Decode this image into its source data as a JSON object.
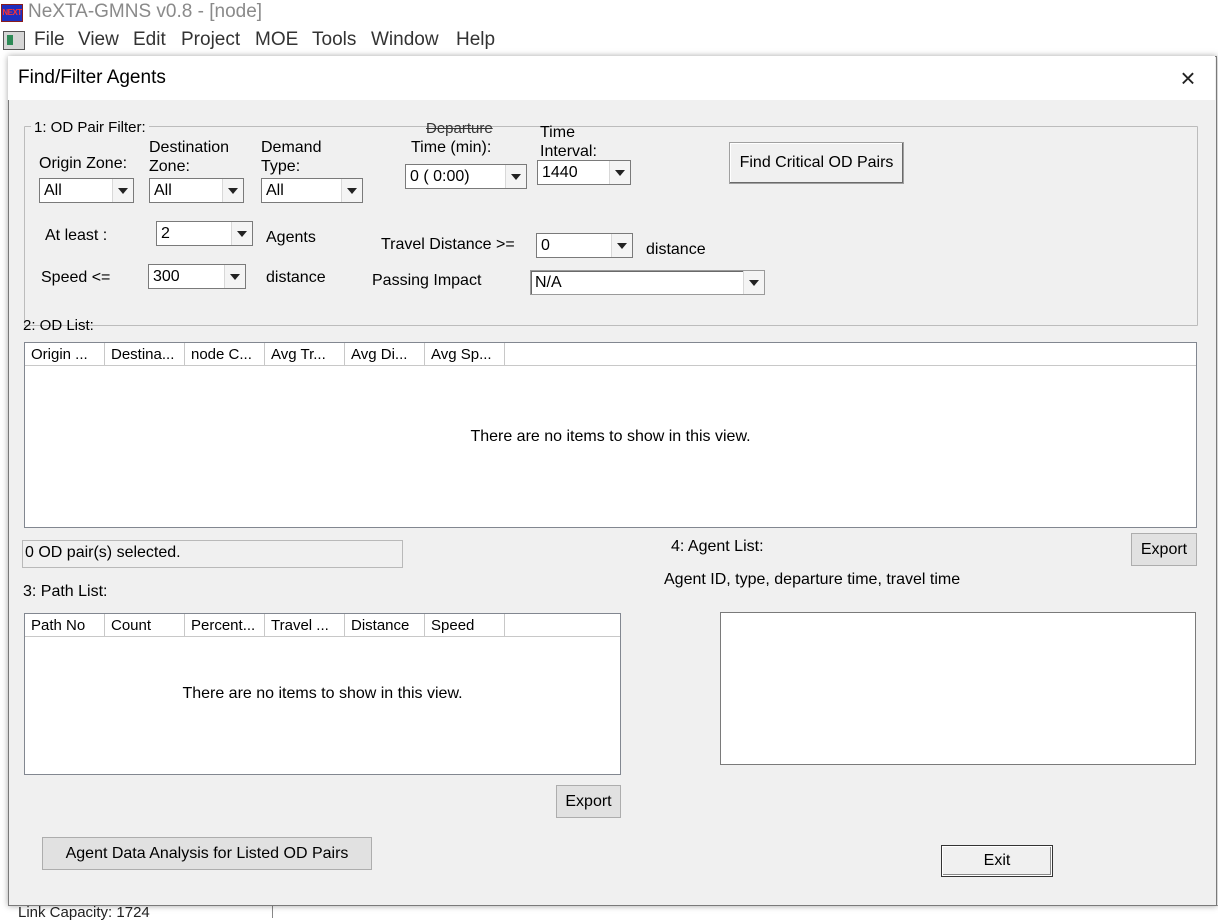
{
  "app": {
    "title": "NeXTA-GMNS v0.8 - [node]",
    "icon_text": "NEXT",
    "menu": [
      "File",
      "View",
      "Edit",
      "Project",
      "MOE",
      "Tools",
      "Window",
      "Help"
    ],
    "background_status": "Link Capacity: 1724"
  },
  "dialog": {
    "title": "Find/Filter Agents",
    "close_glyph": "×",
    "od_filter": {
      "legend": "1: OD Pair Filter:",
      "origin_zone_label": "Origin Zone:",
      "origin_zone_value": "All",
      "destination_zone_label_1": "Destination",
      "destination_zone_label_2": "Zone:",
      "destination_zone_value": "All",
      "demand_type_label_1": "Demand",
      "demand_type_label_2": "Type:",
      "demand_type_value": "All",
      "departure_label_1": "Departure",
      "departure_label_2": "Time (min):",
      "departure_value": "0 ( 0:00)",
      "time_interval_label_1": "Time",
      "time_interval_label_2": "Interval:",
      "time_interval_value": "1440",
      "find_critical_button": "Find Critical OD Pairs",
      "at_least_label": "At least :",
      "at_least_value": "2",
      "agents_label": "Agents",
      "travel_distance_label": "Travel Distance >=",
      "travel_distance_value": "0",
      "travel_distance_unit": "distance",
      "speed_label": "Speed <=",
      "speed_value": "300",
      "speed_unit": "distance",
      "passing_impact_label": "Passing Impact",
      "passing_impact_value": "N/A"
    },
    "od_list": {
      "label": "2: OD List:",
      "columns": [
        "Origin ...",
        "Destina...",
        "node C...",
        "Avg Tr...",
        "Avg Di...",
        "Avg Sp..."
      ],
      "empty_text": "There are no items to show in this view.",
      "selected_status": "0 OD pair(s) selected."
    },
    "path_list": {
      "label": "3: Path List:",
      "columns": [
        "Path No",
        "Count",
        "Percent...",
        "Travel ...",
        "Distance",
        "Speed"
      ],
      "empty_text": "There are no items to show in this view.",
      "export_button": "Export"
    },
    "agent_list": {
      "label": "4: Agent List:",
      "subtitle": "Agent ID, type, departure time, travel time",
      "export_button": "Export"
    },
    "analysis_button": "Agent Data Analysis for Listed OD Pairs",
    "exit_button": "Exit"
  }
}
